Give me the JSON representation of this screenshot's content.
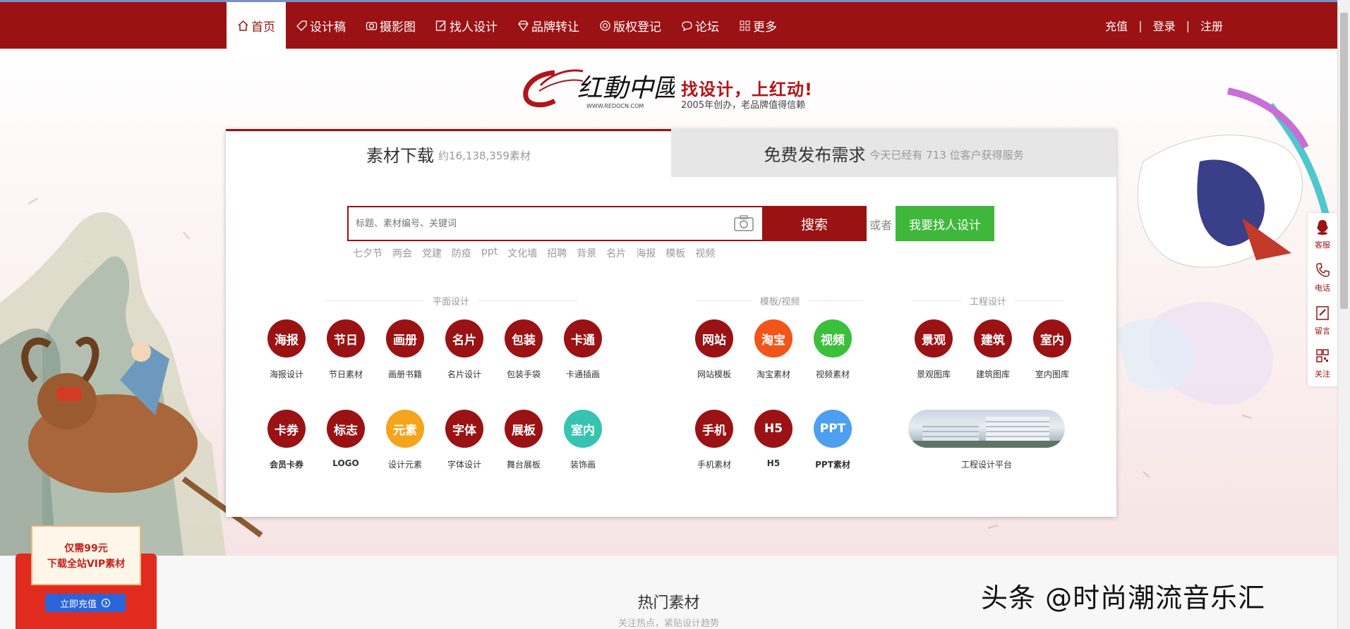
{
  "nav": {
    "items": [
      {
        "label": "首页",
        "icon": "home-icon",
        "active": true
      },
      {
        "label": "设计稿",
        "icon": "tag-icon"
      },
      {
        "label": "摄影图",
        "icon": "camera-icon"
      },
      {
        "label": "找人设计",
        "icon": "edit-icon"
      },
      {
        "label": "品牌转让",
        "icon": "diamond-icon"
      },
      {
        "label": "版权登记",
        "icon": "copyright-icon"
      },
      {
        "label": "论坛",
        "icon": "chat-icon"
      },
      {
        "label": "更多",
        "icon": "grid-icon"
      }
    ],
    "recharge": "充值",
    "login": "登录",
    "register": "注册",
    "separator": "|"
  },
  "brand": {
    "logo_text": "红動中國",
    "logo_url_text": "WWW.REDOCN.COM",
    "slogan": "找设计，上红动!",
    "slogan_sub": "2005年创办，老品牌值得信赖"
  },
  "tabs": {
    "material": {
      "label": "素材下载",
      "sub": "约16,138,359素材"
    },
    "demand": {
      "label": "免费发布需求",
      "sub": "今天已经有  713  位客户获得服务"
    }
  },
  "search": {
    "placeholder": "标题、素材编号、关键词",
    "button": "搜索",
    "or": "或者",
    "find_designer": "我要找人设计",
    "hotwords": [
      "七夕节",
      "两会",
      "党建",
      "防疫",
      "ppt",
      "文化墙",
      "招聘",
      "背景",
      "名片",
      "海报",
      "模板",
      "视频"
    ]
  },
  "categories": {
    "graphic": {
      "title": "平面设计",
      "items": [
        {
          "circle": "海报",
          "label": "海报设计",
          "color": "#9a1214"
        },
        {
          "circle": "节日",
          "label": "节日素材",
          "color": "#9a1214"
        },
        {
          "circle": "画册",
          "label": "画册书籍",
          "color": "#9a1214"
        },
        {
          "circle": "名片",
          "label": "名片设计",
          "color": "#9a1214"
        },
        {
          "circle": "包装",
          "label": "包装手袋",
          "color": "#9a1214"
        },
        {
          "circle": "卡通",
          "label": "卡通插画",
          "color": "#9a1214"
        },
        {
          "circle": "卡券",
          "label": "会员卡券",
          "color": "#9a1214"
        },
        {
          "circle": "标志",
          "label": "LOGO",
          "color": "#9a1214"
        },
        {
          "circle": "元素",
          "label": "设计元素",
          "color": "#f4a51c"
        },
        {
          "circle": "字体",
          "label": "字体设计",
          "color": "#9a1214"
        },
        {
          "circle": "展板",
          "label": "舞台展板",
          "color": "#9a1214"
        },
        {
          "circle": "室内",
          "label": "装饰画",
          "color": "#36c4b0"
        }
      ]
    },
    "template": {
      "title": "模板/视频",
      "items": [
        {
          "circle": "网站",
          "label": "网站模板",
          "color": "#9a1214"
        },
        {
          "circle": "淘宝",
          "label": "淘宝素材",
          "color": "#f2551a"
        },
        {
          "circle": "视频",
          "label": "视频素材",
          "color": "#3cbf3a"
        },
        {
          "circle": "手机",
          "label": "手机素材",
          "color": "#9a1214"
        },
        {
          "circle": "H5",
          "label": "H5",
          "color": "#9a1214"
        },
        {
          "circle": "PPT",
          "label": "PPT素材",
          "color": "#4d9ff0"
        }
      ]
    },
    "engineering": {
      "title": "工程设计",
      "items": [
        {
          "circle": "景观",
          "label": "景观图库",
          "color": "#9a1214"
        },
        {
          "circle": "建筑",
          "label": "建筑图库",
          "color": "#9a1214"
        },
        {
          "circle": "室内",
          "label": "室内图库",
          "color": "#9a1214"
        }
      ],
      "platform_label": "工程设计平台"
    }
  },
  "sidebar": [
    {
      "label": "客服",
      "icon": "qq-icon"
    },
    {
      "label": "电话",
      "icon": "phone-icon"
    },
    {
      "label": "留言",
      "icon": "message-edit-icon"
    },
    {
      "label": "关注",
      "icon": "qrcode-icon"
    }
  ],
  "vip": {
    "line1": "仅需99元",
    "line2": "下载全站VIP素材",
    "button": "立即充值"
  },
  "hot": {
    "title": "热门素材",
    "sub": "关注热点，紧贴设计趋势"
  },
  "watermark": "头条 @时尚潮流音乐汇"
}
